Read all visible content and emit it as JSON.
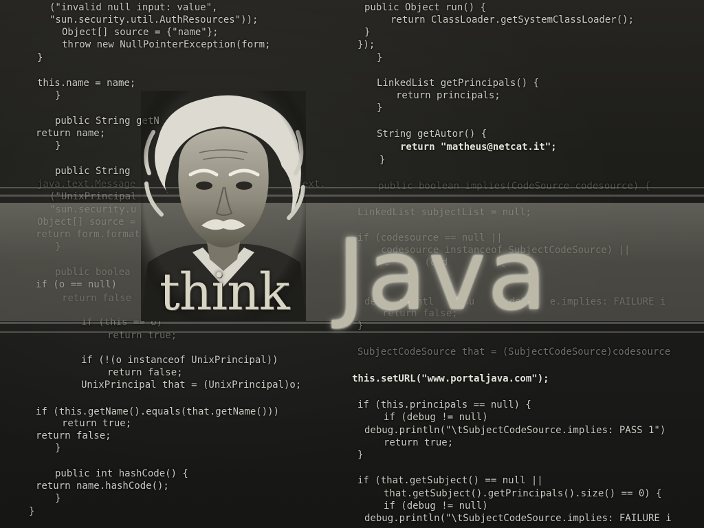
{
  "code": {
    "left": [
      "(\"invalid null input: value\",",
      "\"sun.security.util.AuthResources\"));",
      "Object[] source = {\"name\"};",
      "throw new NullPointerException(form;",
      "}",
      "this.name = name;",
      "}",
      "public String getN",
      "return name;",
      "}",
      "public String",
      "java.text.Message",
      "(\"UnixPrincipal",
      "\"sun.security.u",
      "Object[] source =",
      "return form.format",
      "}",
      "public boolea",
      "if (o == null)",
      "return false",
      "if (this == o)",
      "return true;",
      "if (!(o instanceof UnixPrincipal))",
      "return false;",
      "UnixPrincipal that = (UnixPrincipal)o;",
      "if (this.getName().equals(that.getName()))",
      "return true;",
      "return false;",
      "}",
      "public int hashCode() {",
      "return name.hashCode();",
      "}",
      "}"
    ],
    "left_fragment": "ext.",
    "right": [
      "public Object run() {",
      "return ClassLoader.getSystemClassLoader();",
      "}",
      "});",
      "}",
      "LinkedList getPrincipals() {",
      "return principals;",
      "}",
      "String getAutor() {",
      "return \"matheus@netcat.it\";",
      "}",
      "public boolean implies(CodeSource codesource) {",
      "LinkedList subjectList = null;",
      "if (codesource == null ||",
      "codesource instanceof SubjectCodeSource) ||",
      "su      (cod         {",
      "deb  .printl  \"\\tSu      deSou  e.implies: FAILURE i",
      "return false;",
      "}",
      "SubjectCodeSource that = (SubjectCodeSource)codesource",
      "this.setURL(\"www.portaljava.com\");",
      "if (this.principals == null) {",
      "if (debug != null)",
      "debug.println(\"\\tSubjectCodeSource.implies: PASS 1\")",
      "return true;",
      "}",
      "if (that.getSubject() == null ||",
      "that.getSubject().getPrincipals().size() == 0) {",
      "if (debug != null)",
      "debug.println(\"\\tSubjectCodeSource.implies: FAILURE i"
    ]
  },
  "title": {
    "think": "think",
    "java": "Java"
  },
  "portrait": {
    "subject": "portrait-of-einstein"
  },
  "colors": {
    "background": "#1b1b19",
    "code_text": "#c9c9c1",
    "band": "#8f8c80",
    "java_text": "#bdb9a8",
    "think_text": "#d8d5c5"
  }
}
